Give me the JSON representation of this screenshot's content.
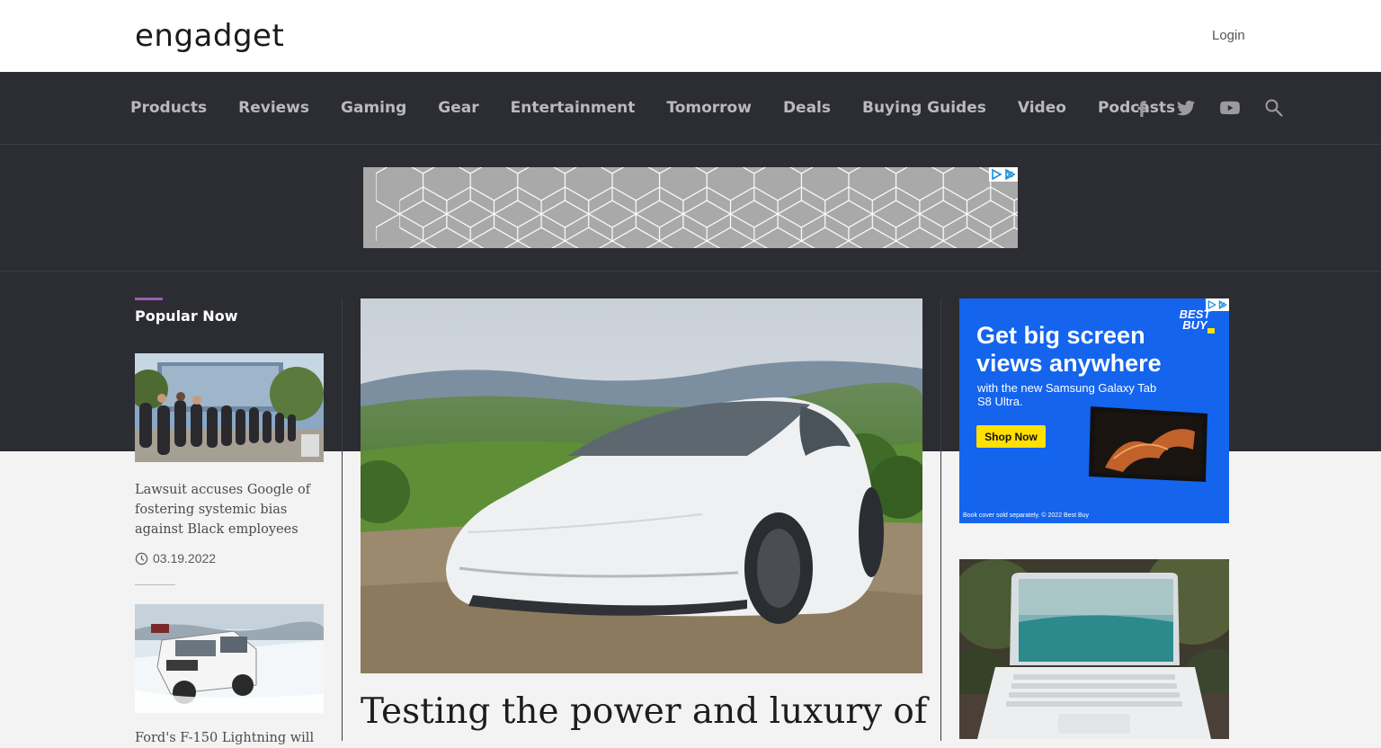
{
  "header": {
    "logo_text": "engadget",
    "login_label": "Login"
  },
  "nav": {
    "items": [
      "Products",
      "Reviews",
      "Gaming",
      "Gear",
      "Entertainment",
      "Tomorrow",
      "Deals",
      "Buying Guides",
      "Video",
      "Podcasts"
    ],
    "icons": [
      "facebook-icon",
      "twitter-icon",
      "youtube-icon",
      "search-icon"
    ]
  },
  "popular": {
    "title": "Popular Now",
    "articles": [
      {
        "headline": "Lawsuit accuses Google of fostering systemic bias against Black employees",
        "date": "03.19.2022"
      },
      {
        "headline": "Ford's F-150 Lightning will"
      }
    ]
  },
  "hero": {
    "title": "Testing the power and luxury of"
  },
  "side_ad": {
    "headline_line1": "Get big screen",
    "headline_line2": "views anywhere",
    "sub_line1": "with the new Samsung Galaxy Tab",
    "sub_line2": "S8 Ultra.",
    "cta": "Shop Now",
    "fine_print": "Book cover sold separately. © 2022 Best Buy",
    "brand_line1": "BEST",
    "brand_line2": "BUY"
  },
  "colors": {
    "nav_bg": "#2c2d33",
    "accent": "#9c5cb4",
    "ad_blue": "#1464ee",
    "ad_yellow": "#ffe000"
  }
}
